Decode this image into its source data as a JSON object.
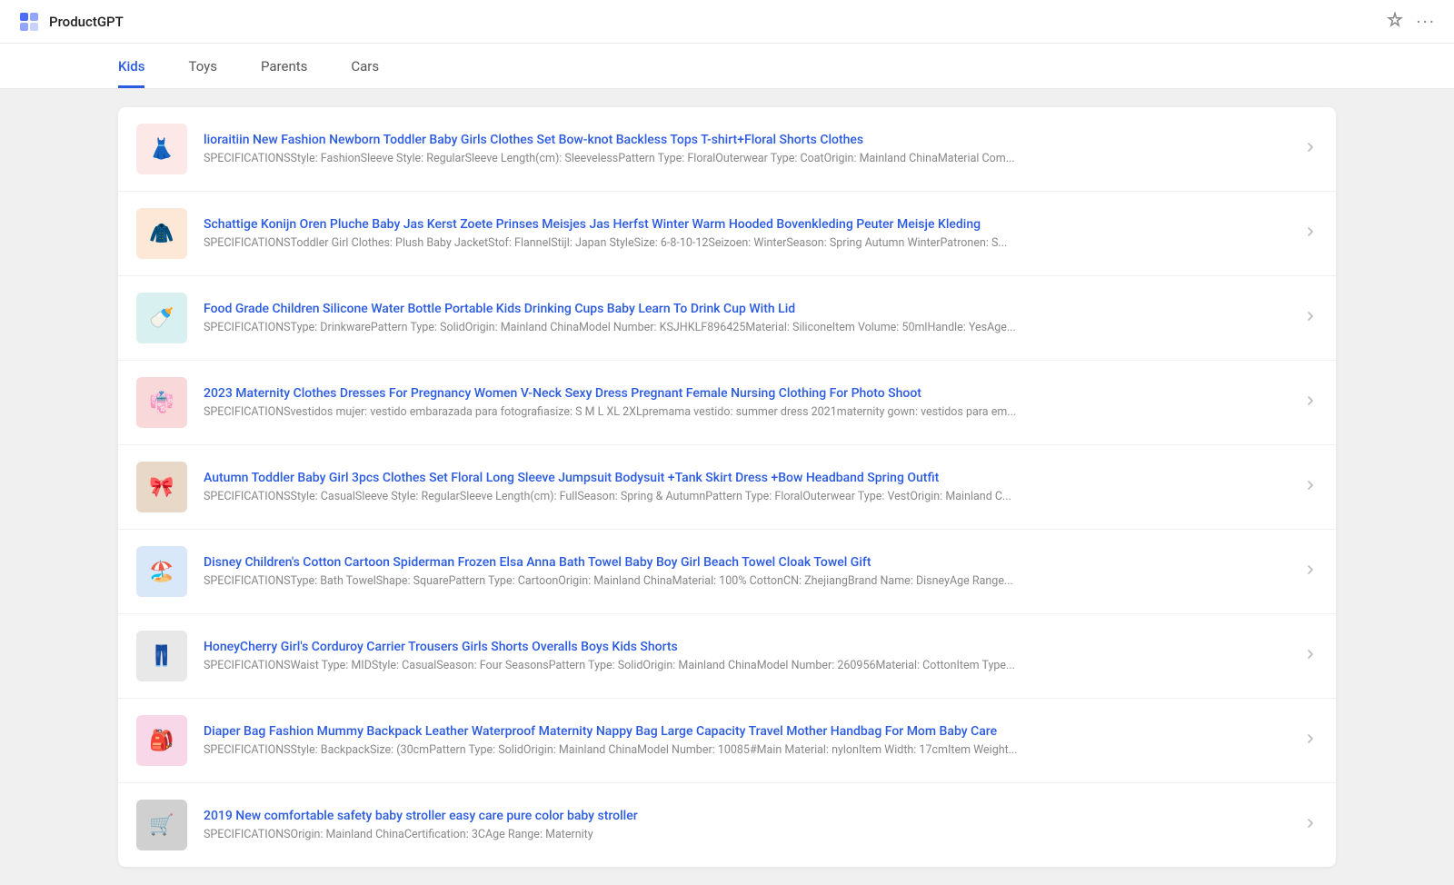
{
  "app": {
    "title": "ProductGPT"
  },
  "header": {
    "pin_icon": "📌",
    "more_icon": "···"
  },
  "tabs": [
    {
      "id": "kids",
      "label": "Kids",
      "active": true
    },
    {
      "id": "toys",
      "label": "Toys",
      "active": false
    },
    {
      "id": "parents",
      "label": "Parents",
      "active": false
    },
    {
      "id": "cars",
      "label": "Cars",
      "active": false
    }
  ],
  "products": [
    {
      "id": 1,
      "title": "lioraitiin New Fashion Newborn Toddler Baby Girls Clothes Set Bow-knot Backless Tops T-shirt+Floral Shorts Clothes",
      "spec": "SPECIFICATIONSStyle: FashionSleeve Style: RegularSleeve Length(cm): SleevelessPattern Type: FloralOuterwear Type: CoatOrigin: Mainland ChinaMaterial Com...",
      "img_class": "img-pink",
      "img_emoji": "👗"
    },
    {
      "id": 2,
      "title": "Schattige Konijn Oren Pluche Baby Jas Kerst Zoete Prinses Meisjes Jas Herfst Winter Warm Hooded Bovenkleding Peuter Meisje Kleding",
      "spec": "SPECIFICATIONSToddler Girl Clothes: Plush Baby JacketStof: FlannelStijl: Japan StyleSize: 6-8-10-12Seizoen: WinterSeason: Spring Autumn WinterPatronen: S...",
      "img_class": "img-peach",
      "img_emoji": "🧥"
    },
    {
      "id": 3,
      "title": "Food Grade Children Silicone Water Bottle Portable Kids Drinking Cups Baby Learn To Drink Cup With Lid",
      "spec": "SPECIFICATIONSType: DrinkwarePattern Type: SolidOrigin: Mainland ChinaModel Number: KSJHKLF896425Material: SiliconeItem Volume: 50mlHandle: YesAge...",
      "img_class": "img-teal",
      "img_emoji": "🍼"
    },
    {
      "id": 4,
      "title": "2023 Maternity Clothes Dresses For Pregnancy Women V-Neck Sexy Dress Pregnant Female Nursing Clothing For Photo Shoot",
      "spec": "SPECIFICATIONSvestidos mujer: vestido embarazada para fotografiasize: S M L XL 2XLpremama vestido: summer dress 2021maternity gown: vestidos para em...",
      "img_class": "img-red",
      "img_emoji": "👘"
    },
    {
      "id": 5,
      "title": "Autumn Toddler Baby Girl 3pcs Clothes Set Floral Long Sleeve Jumpsuit Bodysuit +Tank Skirt Dress +Bow Headband Spring Outfit",
      "spec": "SPECIFICATIONSStyle: CasualSleeve Style: RegularSleeve Length(cm): FullSeason: Spring & AutumnPattern Type: FloralOuterwear Type: VestOrigin: Mainland C...",
      "img_class": "img-brown",
      "img_emoji": "🎀"
    },
    {
      "id": 6,
      "title": "Disney Children&#39;s Cotton Cartoon Spiderman Frozen Elsa Anna Bath Towel Baby Boy Girl Beach Towel Cloak Towel Gift",
      "spec": "SPECIFICATIONSType: Bath TowelShape: SquarePattern Type: CartoonOrigin: Mainland ChinaMaterial: 100% CottonCN: ZhejiangBrand Name: DisneyAge Range...",
      "img_class": "img-blue",
      "img_emoji": "🏖️"
    },
    {
      "id": 7,
      "title": "HoneyCherry Girl&#39;s Corduroy Carrier Trousers Girls Shorts Overalls Boys Kids Shorts",
      "spec": "SPECIFICATIONSWaist Type: MIDStyle: CasualSeason: Four SeasonsPattern Type: SolidOrigin: Mainland ChinaModel Number: 260956Material: CottonItem Type...",
      "img_class": "img-gray",
      "img_emoji": "👖"
    },
    {
      "id": 8,
      "title": "Diaper Bag Fashion Mummy Backpack Leather Waterproof Maternity Nappy Bag Large Capacity Travel Mother Handbag For Mom Baby Care",
      "spec": "SPECIFICATIONSStyle: BackpackSize: (30cmPattern Type: SolidOrigin: Mainland ChinaModel Number: 10085#Main Material: nylonItem Width: 17cmItem Weight...",
      "img_class": "img-pink2",
      "img_emoji": "🎒"
    },
    {
      "id": 9,
      "title": "2019 New comfortable safety baby stroller easy care pure color baby stroller",
      "spec": "SPECIFICATIONSOrigin: Mainland ChinaCertification: 3CAge Range: Maternity",
      "img_class": "img-dark",
      "img_emoji": "🛒"
    }
  ]
}
